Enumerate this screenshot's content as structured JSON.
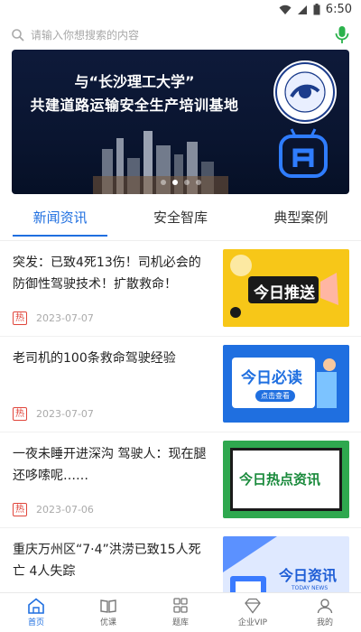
{
  "status": {
    "time": "6:50"
  },
  "search": {
    "placeholder": "请输入你想搜索的内容"
  },
  "banner": {
    "line1": "与“长沙理工大学”",
    "line2": "共建道路运输安全生产培训基地"
  },
  "tabs": [
    {
      "label": "新闻资讯",
      "active": true
    },
    {
      "label": "安全智库",
      "active": false
    },
    {
      "label": "典型案例",
      "active": false
    }
  ],
  "news": [
    {
      "title": "突发：已致4死13伤！司机必会的防御性驾驶技术！扩散救命！",
      "tag": "热",
      "date": "2023-07-07",
      "thumb": "今日推送"
    },
    {
      "title": "老司机的100条救命驾驶经验",
      "tag": "热",
      "date": "2023-07-07",
      "thumb": "今日必读",
      "thumb_sub": "点击查看"
    },
    {
      "title": "一夜未睡开进深沟 驾驶人：现在腿还哆嗦呢……",
      "tag": "热",
      "date": "2023-07-06",
      "thumb": "今日热点资讯"
    },
    {
      "title": "重庆万州区“7·4”洪涝已致15人死亡 4人失踪",
      "tag": "",
      "date": "",
      "thumb": "今日资讯",
      "thumb_sub": "TODAY NEWS"
    }
  ],
  "nav": [
    {
      "label": "首页",
      "icon": "home-icon",
      "active": true
    },
    {
      "label": "优课",
      "icon": "book-icon",
      "active": false
    },
    {
      "label": "题库",
      "icon": "grid-icon",
      "active": false
    },
    {
      "label": "企业VIP",
      "icon": "diamond-icon",
      "active": false
    },
    {
      "label": "我的",
      "icon": "user-icon",
      "active": false
    }
  ],
  "colors": {
    "accent": "#1f6fe0",
    "hot": "#e0453b"
  }
}
